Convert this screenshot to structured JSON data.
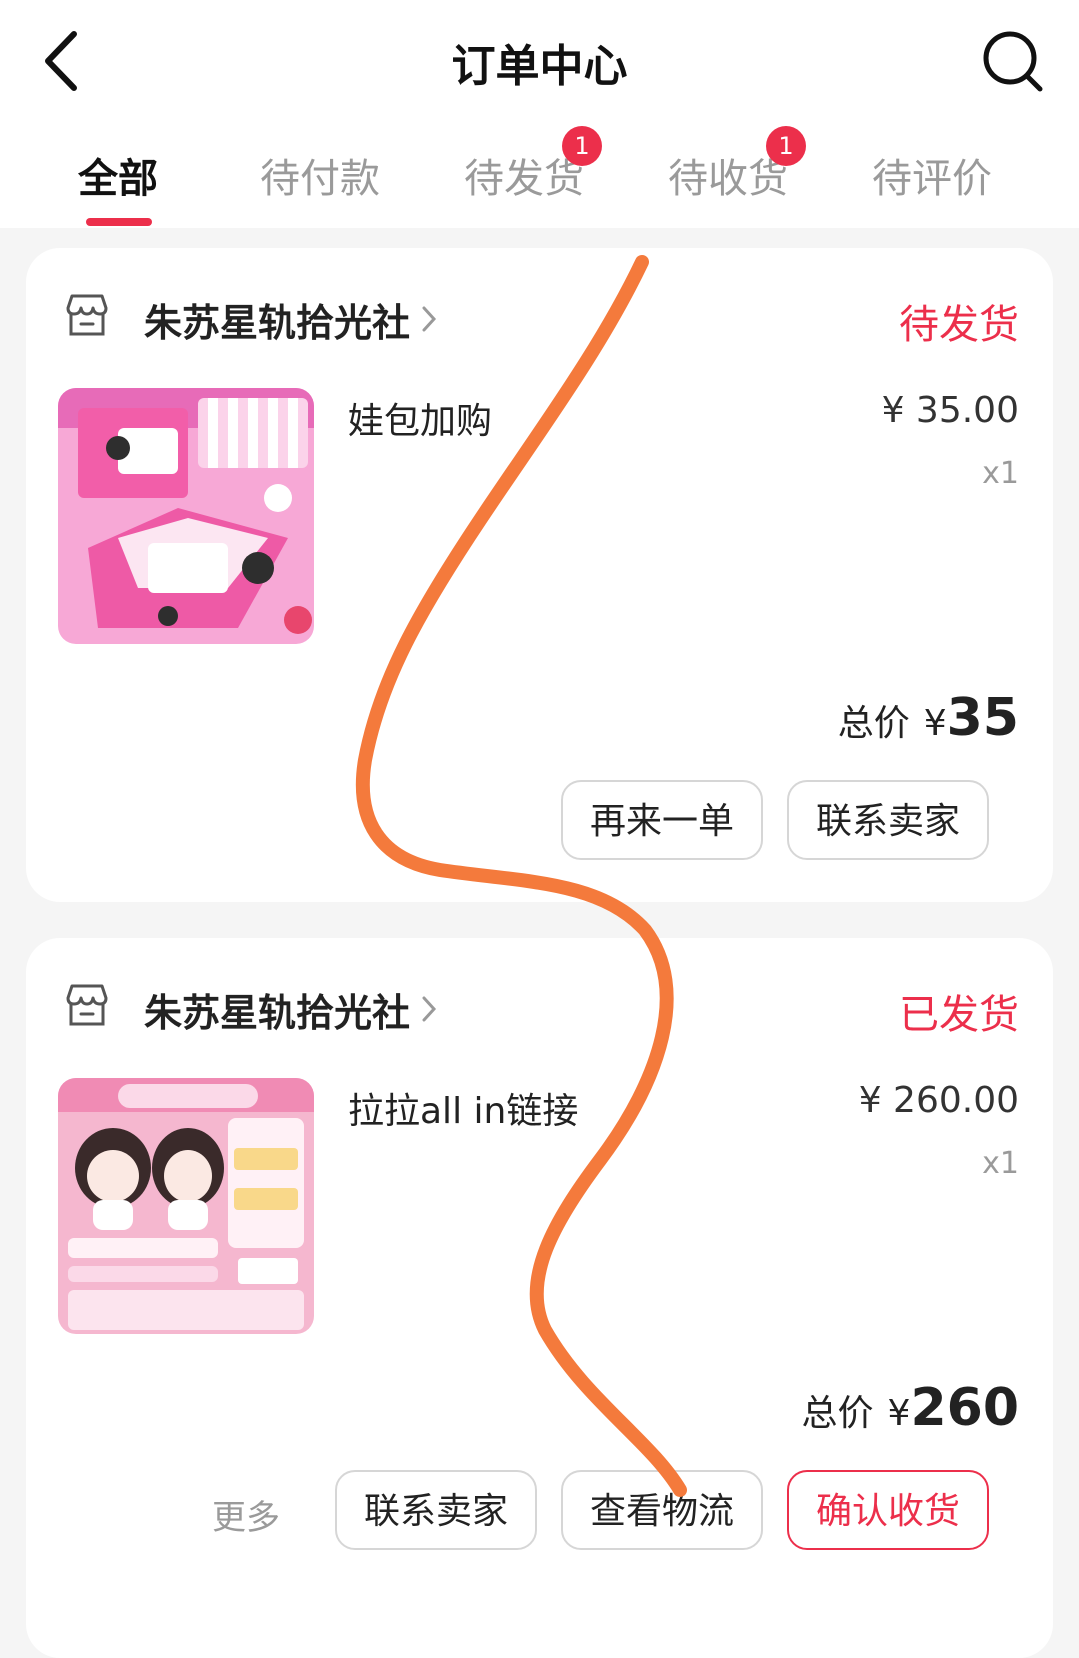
{
  "header": {
    "title": "订单中心"
  },
  "tabs": [
    {
      "label": "全部"
    },
    {
      "label": "待付款"
    },
    {
      "label": "待发货",
      "badge": "1"
    },
    {
      "label": "待收货",
      "badge": "1"
    },
    {
      "label": "待评价"
    }
  ],
  "orders": [
    {
      "shop": "朱苏星轨拾光社",
      "status": "待发货",
      "item": "娃包加购",
      "price": "¥ 35.00",
      "qty": "x1",
      "total_label": "总价",
      "total_currency": "¥",
      "total_value": "35",
      "buttons": [
        "再来一单",
        "联系卖家"
      ]
    },
    {
      "shop": "朱苏星轨拾光社",
      "status": "已发货",
      "item": "拉拉all in链接",
      "price": "¥ 260.00",
      "qty": "x1",
      "total_label": "总价",
      "total_currency": "¥",
      "total_value": "260",
      "more": "更多",
      "buttons": [
        "联系卖家",
        "查看物流",
        "确认收货"
      ]
    }
  ],
  "colors": {
    "accent": "#ec2f4b",
    "scribble": "#f47a3c"
  }
}
